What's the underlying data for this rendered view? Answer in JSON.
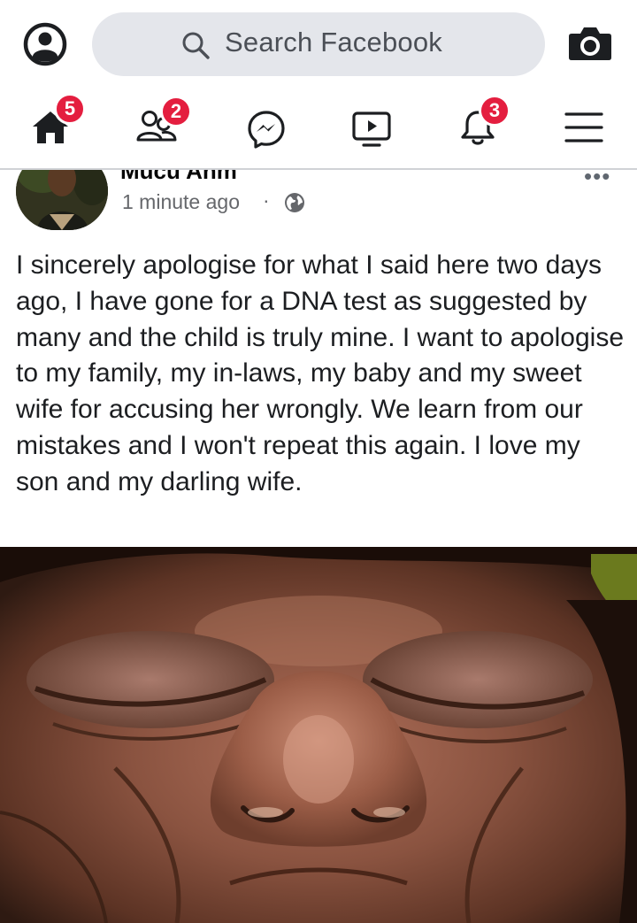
{
  "search": {
    "placeholder": "Search Facebook",
    "icon": "search-icon"
  },
  "topbar": {
    "profile_icon": "user-circle-icon",
    "camera_icon": "camera-icon"
  },
  "nav": {
    "items": [
      {
        "name": "home",
        "icon": "home-icon",
        "badge": "5",
        "active": true
      },
      {
        "name": "friends",
        "icon": "friends-icon",
        "badge": "2"
      },
      {
        "name": "messenger",
        "icon": "messenger-icon",
        "badge": ""
      },
      {
        "name": "watch",
        "icon": "video-play-icon",
        "badge": ""
      },
      {
        "name": "notifications",
        "icon": "bell-icon",
        "badge": "3"
      },
      {
        "name": "menu",
        "icon": "hamburger-menu-icon",
        "badge": ""
      }
    ],
    "badge_color": "#e41e3f"
  },
  "post": {
    "author": "Mucu Anm",
    "time": "1 minute ago",
    "separator": "·",
    "audience_icon": "globe-icon",
    "more": "•••",
    "text": "I sincerely apologise for what I said here two days ago, I have gone for a DNA test as suggested by many and the child is truly mine. I want to apologise to my family, my in-laws, my baby and my sweet wife for accusing her wrongly. We learn from our mistakes and I won't repeat this again. I love my son and my darling wife."
  }
}
